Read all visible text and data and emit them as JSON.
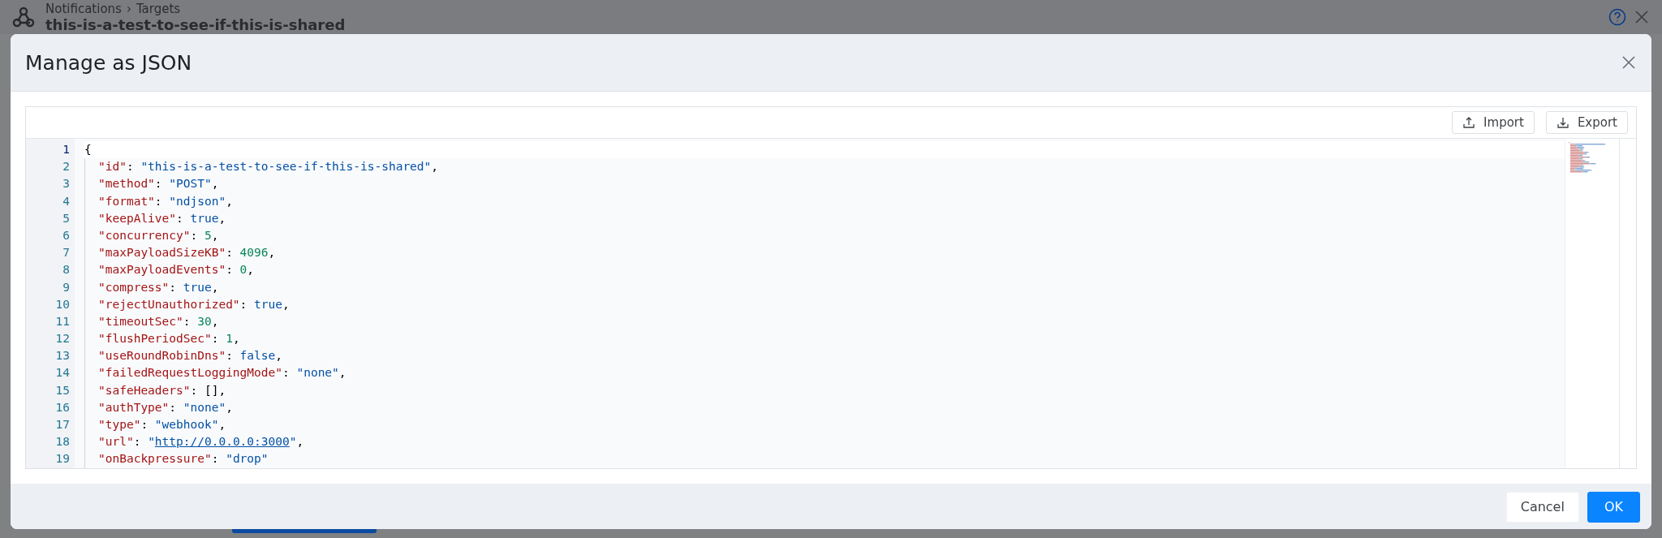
{
  "page": {
    "breadcrumb": [
      {
        "label": "Notifications"
      },
      {
        "label": "Targets"
      }
    ],
    "separator": "›",
    "title": "this-is-a-test-to-see-if-this-is-shared"
  },
  "dialog": {
    "title": "Manage as JSON",
    "toolbar": [
      {
        "label": "Import",
        "kind": "import"
      },
      {
        "label": "Export",
        "kind": "export"
      }
    ],
    "editor": {
      "lines": [
        {
          "number": "1",
          "selected": true,
          "tokens": [
            {
              "kind": "punct",
              "text": "{"
            }
          ]
        },
        {
          "number": "2",
          "selected": false,
          "tokens": [
            {
              "kind": "key",
              "text": "\"id\""
            },
            {
              "kind": "punct",
              "text": ": "
            },
            {
              "kind": "string",
              "text": "\"this-is-a-test-to-see-if-this-is-shared\""
            },
            {
              "kind": "punct",
              "text": ","
            }
          ]
        },
        {
          "number": "3",
          "selected": false,
          "tokens": [
            {
              "kind": "key",
              "text": "\"method\""
            },
            {
              "kind": "punct",
              "text": ": "
            },
            {
              "kind": "string",
              "text": "\"POST\""
            },
            {
              "kind": "punct",
              "text": ","
            }
          ]
        },
        {
          "number": "4",
          "selected": false,
          "tokens": [
            {
              "kind": "key",
              "text": "\"format\""
            },
            {
              "kind": "punct",
              "text": ": "
            },
            {
              "kind": "string",
              "text": "\"ndjson\""
            },
            {
              "kind": "punct",
              "text": ","
            }
          ]
        },
        {
          "number": "5",
          "selected": false,
          "tokens": [
            {
              "kind": "key",
              "text": "\"keepAlive\""
            },
            {
              "kind": "punct",
              "text": ": "
            },
            {
              "kind": "bool",
              "text": "true"
            },
            {
              "kind": "punct",
              "text": ","
            }
          ]
        },
        {
          "number": "6",
          "selected": false,
          "tokens": [
            {
              "kind": "key",
              "text": "\"concurrency\""
            },
            {
              "kind": "punct",
              "text": ": "
            },
            {
              "kind": "number",
              "text": "5"
            },
            {
              "kind": "punct",
              "text": ","
            }
          ]
        },
        {
          "number": "7",
          "selected": false,
          "tokens": [
            {
              "kind": "key",
              "text": "\"maxPayloadSizeKB\""
            },
            {
              "kind": "punct",
              "text": ": "
            },
            {
              "kind": "number",
              "text": "4096"
            },
            {
              "kind": "punct",
              "text": ","
            }
          ]
        },
        {
          "number": "8",
          "selected": false,
          "tokens": [
            {
              "kind": "key",
              "text": "\"maxPayloadEvents\""
            },
            {
              "kind": "punct",
              "text": ": "
            },
            {
              "kind": "number",
              "text": "0"
            },
            {
              "kind": "punct",
              "text": ","
            }
          ]
        },
        {
          "number": "9",
          "selected": false,
          "tokens": [
            {
              "kind": "key",
              "text": "\"compress\""
            },
            {
              "kind": "punct",
              "text": ": "
            },
            {
              "kind": "bool",
              "text": "true"
            },
            {
              "kind": "punct",
              "text": ","
            }
          ]
        },
        {
          "number": "10",
          "selected": false,
          "tokens": [
            {
              "kind": "key",
              "text": "\"rejectUnauthorized\""
            },
            {
              "kind": "punct",
              "text": ": "
            },
            {
              "kind": "bool",
              "text": "true"
            },
            {
              "kind": "punct",
              "text": ","
            }
          ]
        },
        {
          "number": "11",
          "selected": false,
          "tokens": [
            {
              "kind": "key",
              "text": "\"timeoutSec\""
            },
            {
              "kind": "punct",
              "text": ": "
            },
            {
              "kind": "number",
              "text": "30"
            },
            {
              "kind": "punct",
              "text": ","
            }
          ]
        },
        {
          "number": "12",
          "selected": false,
          "tokens": [
            {
              "kind": "key",
              "text": "\"flushPeriodSec\""
            },
            {
              "kind": "punct",
              "text": ": "
            },
            {
              "kind": "number",
              "text": "1"
            },
            {
              "kind": "punct",
              "text": ","
            }
          ]
        },
        {
          "number": "13",
          "selected": false,
          "tokens": [
            {
              "kind": "key",
              "text": "\"useRoundRobinDns\""
            },
            {
              "kind": "punct",
              "text": ": "
            },
            {
              "kind": "bool",
              "text": "false"
            },
            {
              "kind": "punct",
              "text": ","
            }
          ]
        },
        {
          "number": "14",
          "selected": false,
          "tokens": [
            {
              "kind": "key",
              "text": "\"failedRequestLoggingMode\""
            },
            {
              "kind": "punct",
              "text": ": "
            },
            {
              "kind": "string",
              "text": "\"none\""
            },
            {
              "kind": "punct",
              "text": ","
            }
          ]
        },
        {
          "number": "15",
          "selected": false,
          "tokens": [
            {
              "kind": "key",
              "text": "\"safeHeaders\""
            },
            {
              "kind": "punct",
              "text": ": [],"
            }
          ]
        },
        {
          "number": "16",
          "selected": false,
          "tokens": [
            {
              "kind": "key",
              "text": "\"authType\""
            },
            {
              "kind": "punct",
              "text": ": "
            },
            {
              "kind": "string",
              "text": "\"none\""
            },
            {
              "kind": "punct",
              "text": ","
            }
          ]
        },
        {
          "number": "17",
          "selected": false,
          "tokens": [
            {
              "kind": "key",
              "text": "\"type\""
            },
            {
              "kind": "punct",
              "text": ": "
            },
            {
              "kind": "string",
              "text": "\"webhook\""
            },
            {
              "kind": "punct",
              "text": ","
            }
          ]
        },
        {
          "number": "18",
          "selected": false,
          "tokens": [
            {
              "kind": "key",
              "text": "\"url\""
            },
            {
              "kind": "punct",
              "text": ": "
            },
            {
              "kind": "string",
              "text": "\""
            },
            {
              "kind": "link",
              "text": "http://0.0.0.0:3000"
            },
            {
              "kind": "string",
              "text": "\""
            },
            {
              "kind": "punct",
              "text": ","
            }
          ]
        },
        {
          "number": "19",
          "selected": false,
          "tokens": [
            {
              "kind": "key",
              "text": "\"onBackpressure\""
            },
            {
              "kind": "punct",
              "text": ": "
            },
            {
              "kind": "string",
              "text": "\"drop\""
            }
          ]
        }
      ]
    },
    "buttons": [
      {
        "label": "Cancel",
        "kind": "secondary"
      },
      {
        "label": "OK",
        "kind": "primary"
      }
    ]
  }
}
